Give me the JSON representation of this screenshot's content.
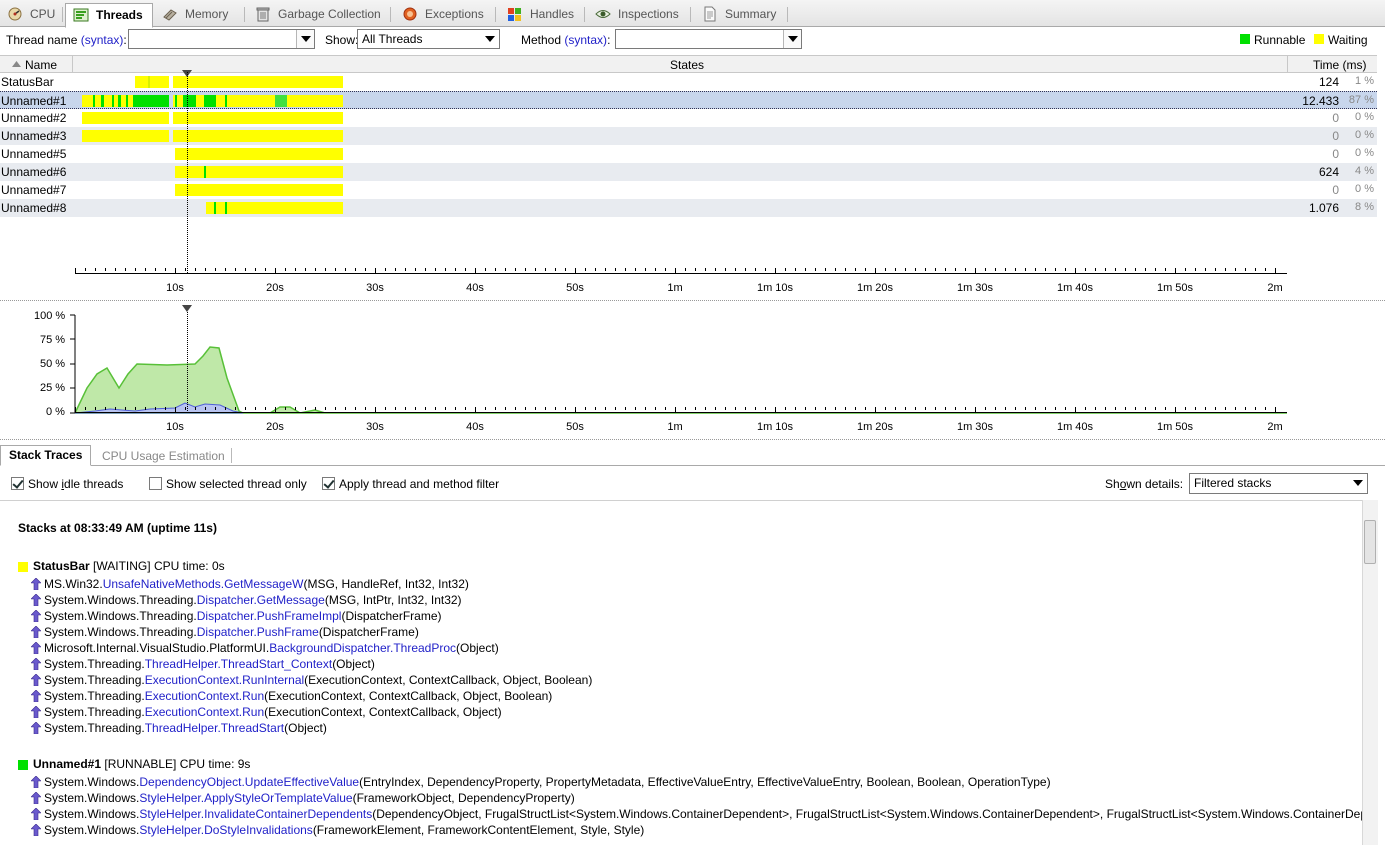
{
  "tabs": [
    {
      "label": "CPU",
      "icon": "cpu-icon",
      "active": false
    },
    {
      "label": "Threads",
      "icon": "threads-icon",
      "active": true
    },
    {
      "label": "Memory",
      "icon": "memory-icon",
      "active": false
    },
    {
      "label": "Garbage Collection",
      "icon": "trash-icon",
      "active": false
    },
    {
      "label": "Exceptions",
      "icon": "exceptions-icon",
      "active": false
    },
    {
      "label": "Handles",
      "icon": "windows-logo-icon",
      "active": false
    },
    {
      "label": "Inspections",
      "icon": "eye-icon",
      "active": false
    },
    {
      "label": "Summary",
      "icon": "document-icon",
      "active": false
    }
  ],
  "filters": {
    "thread_name_label": "Thread name",
    "thread_name_link": "(syntax)",
    "thread_name_colon": ":",
    "thread_name_value": "",
    "show_label": "Show:",
    "show_value": "All Threads",
    "method_label": "Method",
    "method_link": "(syntax)",
    "method_colon": ":",
    "method_value": ""
  },
  "legend": {
    "runnable_label": "Runnable",
    "runnable_color": "#00e000",
    "waiting_label": "Waiting",
    "waiting_color": "#ffff00"
  },
  "grid": {
    "col_name": "Name",
    "col_states": "States",
    "col_time": "Time (ms)",
    "threads": [
      {
        "name": "StatusBar",
        "time": "124",
        "pct": "1 %",
        "selected": false
      },
      {
        "name": "Unnamed#1",
        "time": "12.433",
        "pct": "87 %",
        "selected": true
      },
      {
        "name": "Unnamed#2",
        "time": "0",
        "pct": "0 %",
        "selected": false
      },
      {
        "name": "Unnamed#3",
        "time": "0",
        "pct": "0 %",
        "selected": false
      },
      {
        "name": "Unnamed#5",
        "time": "0",
        "pct": "0 %",
        "selected": false
      },
      {
        "name": "Unnamed#6",
        "time": "624",
        "pct": "4 %",
        "selected": false
      },
      {
        "name": "Unnamed#7",
        "time": "0",
        "pct": "0 %",
        "selected": false
      },
      {
        "name": "Unnamed#8",
        "time": "1.076",
        "pct": "8 %",
        "selected": false
      }
    ]
  },
  "timeline": {
    "labels": [
      "10s",
      "20s",
      "30s",
      "40s",
      "50s",
      "1m",
      "1m 10s",
      "1m 20s",
      "1m 30s",
      "1m 40s",
      "1m 50s",
      "2m"
    ]
  },
  "cpu_chart": {
    "y_labels": [
      "100 %",
      "75 %",
      "50 %",
      "25 %",
      "0 %"
    ]
  },
  "bottom_tabs": [
    "Stack Traces",
    "CPU Usage Estimation"
  ],
  "options": {
    "show_idle_pre": "Show ",
    "show_idle_u": "i",
    "show_idle_post": "dle threads",
    "show_selected": "Show selected thread only",
    "apply_filter": "Apply thread and method filter",
    "shown_details_pre": "Sh",
    "shown_details_u": "o",
    "shown_details_post": "wn details:",
    "shown_details_value": "Filtered stacks"
  },
  "stacks_header": "Stacks at 08:33:49 AM (uptime 11s)",
  "stack_groups": [
    {
      "thread": "StatusBar",
      "state": "[WAITING]",
      "cpu": "CPU time: 0s",
      "color": "#ffff00",
      "frames": [
        {
          "ns": "MS.Win32.",
          "cls": "UnsafeNativeMethods",
          "sep": ".",
          "meth": "GetMessageW",
          "args": "(MSG, HandleRef, Int32, Int32)"
        },
        {
          "ns": "System.Windows.Threading.",
          "cls": "Dispatcher",
          "sep": ".",
          "meth": "GetMessage",
          "args": "(MSG, IntPtr, Int32, Int32)"
        },
        {
          "ns": "System.Windows.Threading.",
          "cls": "Dispatcher",
          "sep": ".",
          "meth": "PushFrameImpl",
          "args": "(DispatcherFrame)"
        },
        {
          "ns": "System.Windows.Threading.",
          "cls": "Dispatcher",
          "sep": ".",
          "meth": "PushFrame",
          "args": "(DispatcherFrame)"
        },
        {
          "ns": "Microsoft.Internal.VisualStudio.PlatformUI.",
          "cls": "BackgroundDispatcher",
          "sep": ".",
          "meth": "ThreadProc",
          "args": "(Object)"
        },
        {
          "ns": "System.Threading.",
          "cls": "ThreadHelper",
          "sep": ".",
          "meth": "ThreadStart_Context",
          "args": "(Object)"
        },
        {
          "ns": "System.Threading.",
          "cls": "ExecutionContext",
          "sep": ".",
          "meth": "RunInternal",
          "args": "(ExecutionContext, ContextCallback, Object, Boolean)"
        },
        {
          "ns": "System.Threading.",
          "cls": "ExecutionContext",
          "sep": ".",
          "meth": "Run",
          "args": "(ExecutionContext, ContextCallback, Object, Boolean)"
        },
        {
          "ns": "System.Threading.",
          "cls": "ExecutionContext",
          "sep": ".",
          "meth": "Run",
          "args": "(ExecutionContext, ContextCallback, Object)"
        },
        {
          "ns": "System.Threading.",
          "cls": "ThreadHelper",
          "sep": ".",
          "meth": "ThreadStart",
          "args": "(Object)"
        }
      ]
    },
    {
      "thread": "Unnamed#1",
      "state": "[RUNNABLE]",
      "cpu": "CPU time: 9s",
      "color": "#00e000",
      "frames": [
        {
          "ns": "System.Windows.",
          "cls": "DependencyObject",
          "sep": ".",
          "meth": "UpdateEffectiveValue",
          "args": "(EntryIndex, DependencyProperty, PropertyMetadata, EffectiveValueEntry, EffectiveValueEntry, Boolean, Boolean, OperationType)"
        },
        {
          "ns": "System.Windows.",
          "cls": "StyleHelper",
          "sep": ".",
          "meth": "ApplyStyleOrTemplateValue",
          "args": "(FrameworkObject, DependencyProperty)"
        },
        {
          "ns": "System.Windows.",
          "cls": "StyleHelper",
          "sep": ".",
          "meth": "InvalidateContainerDependents",
          "args": "(DependencyObject, FrugalStructList<System.Windows.ContainerDependent>, FrugalStructList<System.Windows.ContainerDependent>, FrugalStructList<System.Windows.ContainerDepen"
        },
        {
          "ns": "System.Windows.",
          "cls": "StyleHelper",
          "sep": ".",
          "meth": "DoStyleInvalidations",
          "args": "(FrameworkElement, FrameworkContentElement, Style, Style)"
        }
      ]
    }
  ]
}
